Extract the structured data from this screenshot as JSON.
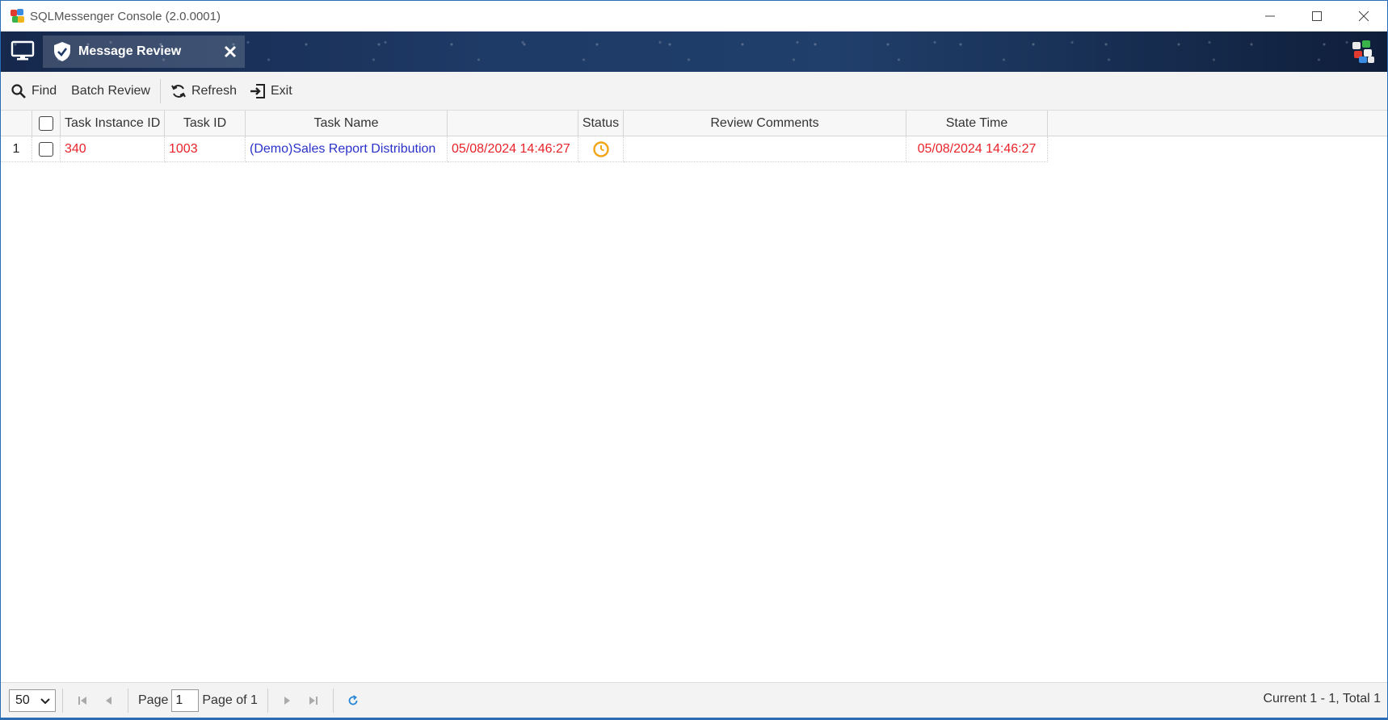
{
  "window": {
    "title": "SQLMessenger Console (2.0.0001)"
  },
  "tab": {
    "label": "Message Review"
  },
  "toolbar": {
    "find": "Find",
    "batch_review": "Batch Review",
    "refresh": "Refresh",
    "exit": "Exit"
  },
  "grid": {
    "headers": {
      "task_instance_id": "Task Instance ID",
      "task_id": "Task ID",
      "task_name": "Task Name",
      "time": "",
      "status": "Status",
      "review_comments": "Review Comments",
      "state_time": "State Time"
    },
    "rows": [
      {
        "num": "1",
        "task_instance_id": "340",
        "task_id": "1003",
        "task_name": "(Demo)Sales Report Distribution",
        "time": "05/08/2024 14:46:27",
        "status_icon": "clock-icon",
        "review_comments": "",
        "state_time": "05/08/2024 14:46:27"
      }
    ]
  },
  "footer": {
    "page_size": "50",
    "page_label": "Page",
    "page_value": "1",
    "page_of": "Page of 1",
    "summary": "Current 1 - 1, Total 1"
  },
  "colors": {
    "accent": "#2a6db5",
    "error_text": "#e8232a",
    "link_text": "#2a32c8",
    "status_clock": "#f2a516"
  }
}
